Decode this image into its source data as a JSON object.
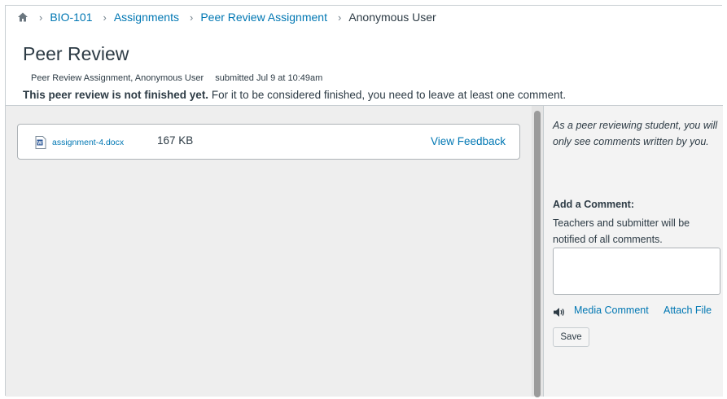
{
  "breadcrumb": {
    "home_icon": "home-icon",
    "items": [
      {
        "label": "BIO-101"
      },
      {
        "label": "Assignments"
      },
      {
        "label": "Peer Review Assignment"
      },
      {
        "label": "Anonymous User"
      }
    ]
  },
  "page": {
    "title": "Peer Review",
    "meta_assignment": "Peer Review Assignment, Anonymous User",
    "meta_submitted": "submitted Jul 9 at 10:49am",
    "notice_bold": "This peer review is not finished yet.",
    "notice_rest": " For it to be considered finished, you need to leave at least one comment."
  },
  "submission": {
    "file_icon": "word-document-icon",
    "file_name": "assignment-4.docx",
    "file_size": "167 KB",
    "view_feedback_label": "View Feedback"
  },
  "sidebar": {
    "note": "As a peer reviewing student, you will only see comments written by you.",
    "add_comment_title": "Add a Comment:",
    "add_comment_help": "Teachers and submitter will be notified of all comments.",
    "comment_value": "",
    "media_icon": "speaker-icon",
    "media_comment_label": "Media Comment",
    "attach_file_label": "Attach File",
    "save_label": "Save"
  },
  "colors": {
    "link": "#0077b3",
    "text": "#2d3b45",
    "pane_bg": "#eeeeee",
    "side_bg": "#f3f3f3"
  }
}
